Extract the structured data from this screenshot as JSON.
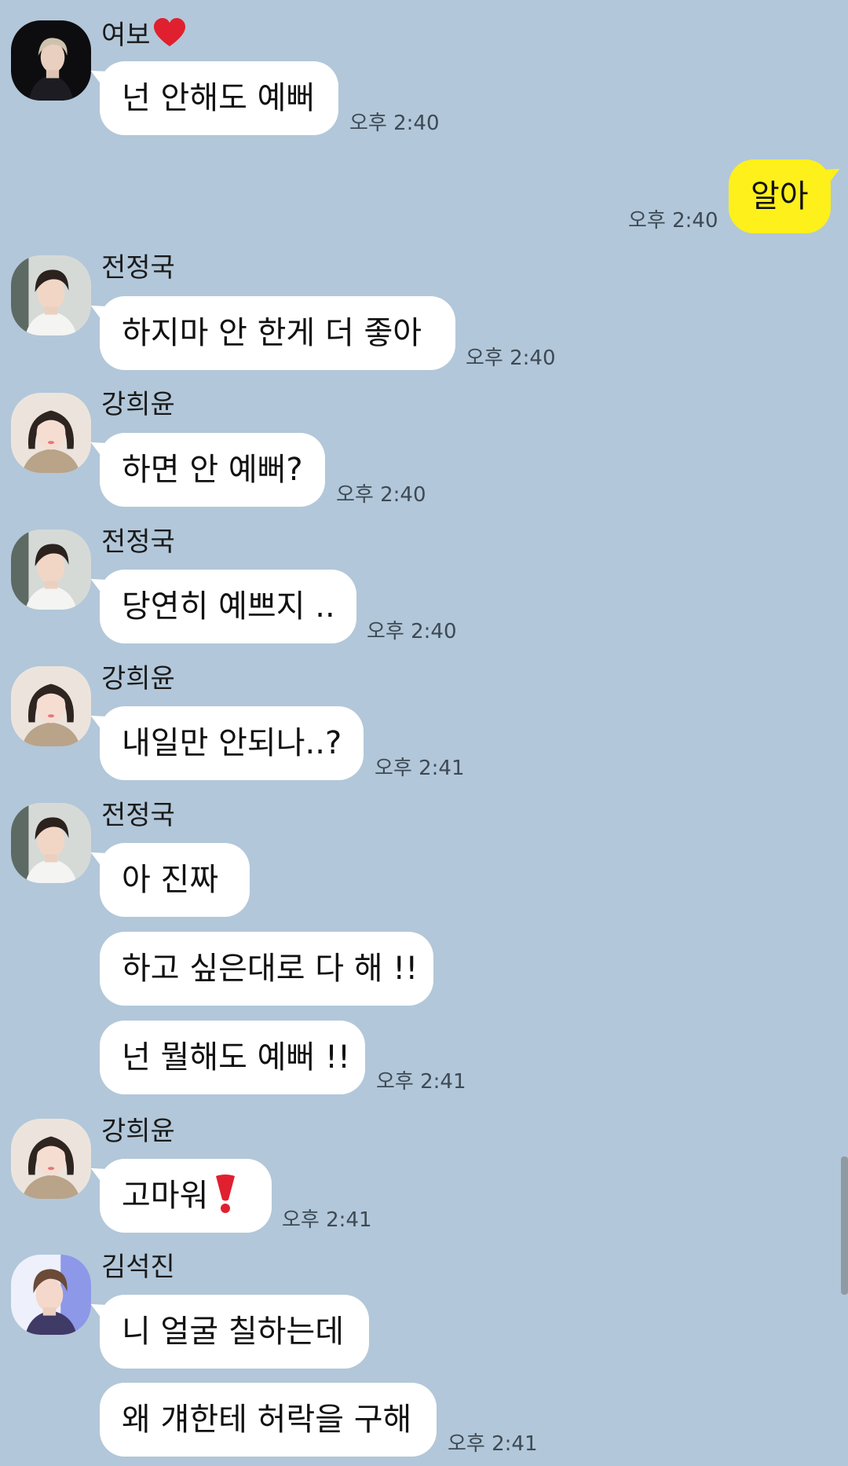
{
  "senders": {
    "yeobo": "여보",
    "jungkook": "전정국",
    "heeyoon": "강희윤",
    "seokjin": "김석진"
  },
  "messages": {
    "m1": "넌 안해도 예뻐",
    "m2": "알아",
    "m3": "하지마 안 한게 더 좋아",
    "m4": "하면 안 예뻐?",
    "m5": "당연히 예쁘지 ..",
    "m6": "내일만 안되나..?",
    "m7": "아 진짜",
    "m8": "하고 싶은대로 다 해 !!",
    "m9": "넌 뭘해도 예뻐 !!",
    "m10": "고마워",
    "m11": "니 얼굴 칠하는데",
    "m12": "왜 걔한테 허락을 구해"
  },
  "times": {
    "t1": "오후 2:40",
    "t2": "오후 2:40",
    "t3": "오후 2:40",
    "t4": "오후 2:40",
    "t5": "오후 2:40",
    "t6": "오후 2:41",
    "t7": "오후 2:41",
    "t8": "오후 2:41",
    "t9": "오후 2:41"
  },
  "icons": {
    "heart": "red-heart-icon",
    "exclamation": "heavy-exclamation-icon"
  },
  "colors": {
    "background": "#b2c7d9",
    "my_bubble": "#fef01b",
    "other_bubble": "#ffffff",
    "heart": "#e0202e"
  }
}
